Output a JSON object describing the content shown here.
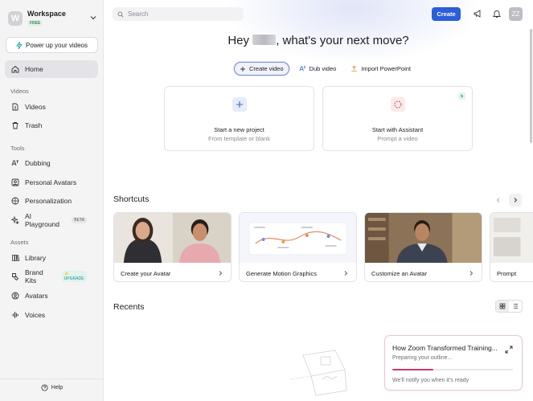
{
  "workspace": {
    "name": "Workspace",
    "initial": "W",
    "plan_badge": "FREE"
  },
  "sidebar": {
    "power_label": "Power up your videos",
    "home": "Home",
    "videos_section": "Videos",
    "videos": "Videos",
    "trash": "Trash",
    "tools_section": "Tools",
    "dubbing": "Dubbing",
    "personal_avatars": "Personal Avatars",
    "personalization": "Personalization",
    "ai_playground": "AI Playground",
    "ai_playground_badge": "BETA",
    "assets_section": "Assets",
    "library": "Library",
    "brand_kits": "Brand Kits",
    "brand_kits_badge": "UPGRADE",
    "avatars": "Avatars",
    "voices": "Voices",
    "help": "Help"
  },
  "header": {
    "search_placeholder": "Search",
    "create_label": "Create",
    "user_initials": "ZZ"
  },
  "hero": {
    "prefix": "Hey",
    "suffix": ", what's your next move?"
  },
  "tabs": {
    "create_video": "Create video",
    "dub_video": "Dub video",
    "import_ppt": "Import PowerPoint"
  },
  "cards": {
    "new_project_title": "Start a new project",
    "new_project_sub": "From template or blank",
    "assistant_title": "Start with Assistant",
    "assistant_sub": "Prompt a video"
  },
  "shortcuts": {
    "title": "Shortcuts",
    "items": [
      "Create your Avatar",
      "Generate Motion Graphics",
      "Customize an Avatar",
      "Prompt"
    ]
  },
  "recents": {
    "title": "Recents"
  },
  "toast": {
    "title": "How Zoom Transformed Training...",
    "status": "Preparing your outline...",
    "note": "We'll notify you when it's ready",
    "progress": 0.34
  },
  "colors": {
    "accent": "#2b5ed8",
    "progress": "#c83b73",
    "badge_green": "#3a8b5e"
  }
}
